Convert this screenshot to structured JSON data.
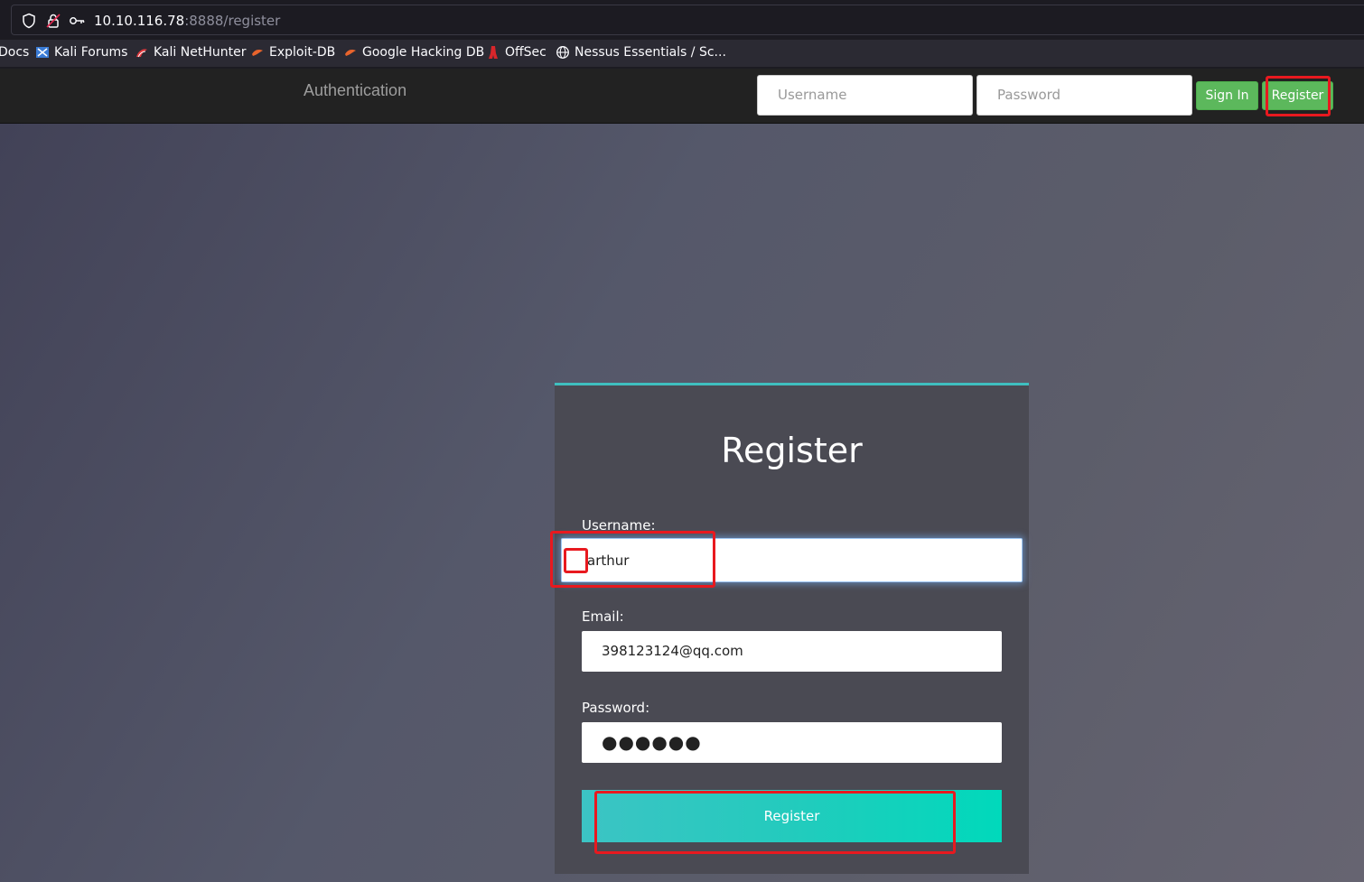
{
  "browser": {
    "url_host": "10.10.116.78",
    "url_rest": ":8888/register",
    "bookmarks": [
      {
        "label": "Docs",
        "icon": "none"
      },
      {
        "label": "Kali Forums",
        "icon": "kali-forums-icon"
      },
      {
        "label": "Kali NetHunter",
        "icon": "kali-nethunter-icon"
      },
      {
        "label": "Exploit-DB",
        "icon": "exploit-db-icon"
      },
      {
        "label": "Google Hacking DB",
        "icon": "ghdb-icon"
      },
      {
        "label": "OffSec",
        "icon": "offsec-icon"
      },
      {
        "label": "Nessus Essentials / Sc...",
        "icon": "globe-icon"
      }
    ]
  },
  "navbar": {
    "brand": "Authentication",
    "username_placeholder": "Username",
    "password_placeholder": "Password",
    "signin_label": "Sign In",
    "register_label": "Register"
  },
  "form": {
    "title": "Register",
    "username_label": "Username:",
    "username_value": "arthur",
    "email_label": "Email:",
    "email_value": "398123124@qq.com",
    "password_label": "Password:",
    "password_value": "●●●●●●",
    "submit_label": "Register"
  },
  "colors": {
    "accent_teal": "#3fbfbf",
    "nav_button_green": "#5cb85c",
    "annotation_red": "#e8191f"
  }
}
